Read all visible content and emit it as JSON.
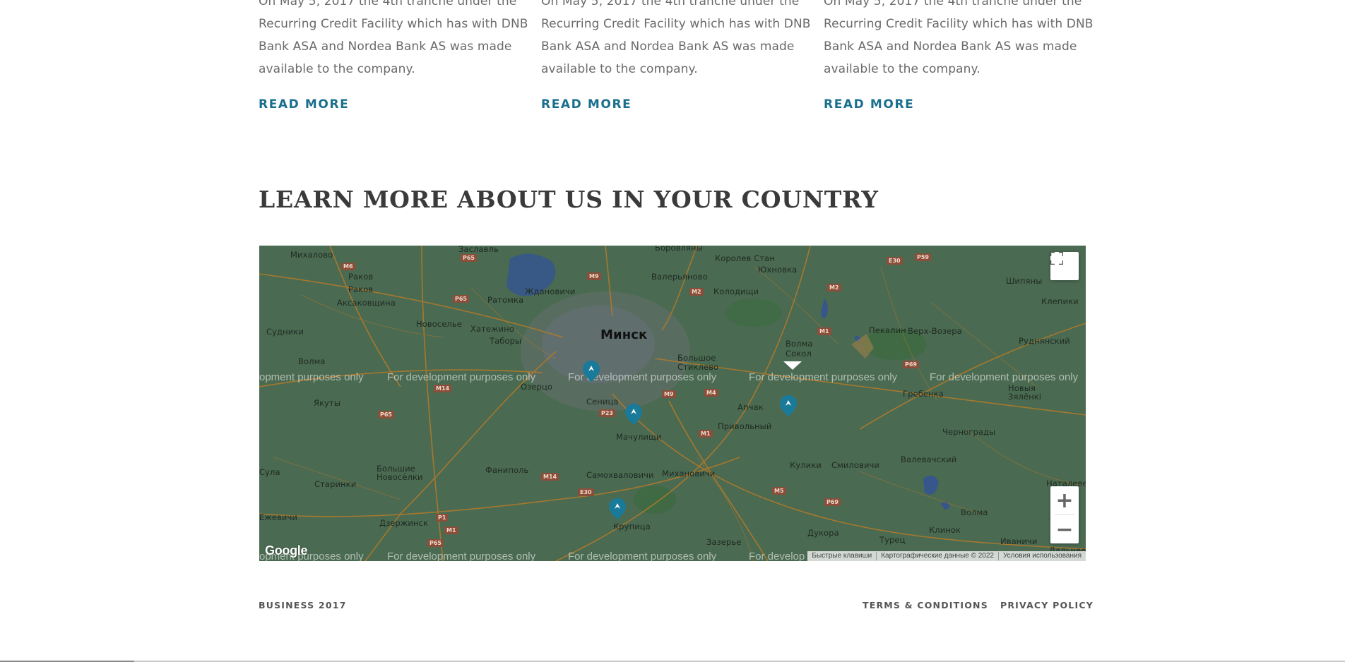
{
  "news": [
    {
      "lines": [
        "On May 5, 2017 the 4th tranche under the",
        "Recurring Credit Facility which has with DNB",
        "Bank ASA and Nordea Bank AS was made",
        "available to the company."
      ],
      "read_more": "READ MORE"
    },
    {
      "lines": [
        "On May 5, 2017 the 4th tranche under the",
        "Recurring Credit Facility which has with DNB",
        "Bank ASA and Nordea Bank AS was made",
        "available to the company."
      ],
      "read_more": "READ MORE"
    },
    {
      "lines": [
        "On May 5, 2017 the 4th tranche under the",
        "Recurring Credit Facility which has with DNB",
        "Bank ASA and Nordea Bank AS was made",
        "available to the company."
      ],
      "read_more": "READ MORE"
    }
  ],
  "section": {
    "heading": "LEARN MORE ABOUT US IN YOUR COUNTRY"
  },
  "map": {
    "city": "Минск",
    "places": [
      "Михалово",
      "Раков",
      "Раков",
      "Аксаковщина",
      "Судники",
      "Волма",
      "Якуты",
      "Сула",
      "Старинки",
      "Ежевичи",
      "Дзержинск",
      "Заславль",
      "Ратомка",
      "Ждановичи",
      "Новоселье",
      "Хатежино",
      "Таборы",
      "Озерцо",
      "Сеница",
      "Мачулищи",
      "Фаниполь",
      "Большие Новосёлки",
      "Самохваловичи",
      "Михановичи",
      "Крупица",
      "Боровляны",
      "Валерьяново",
      "Королев Стан",
      "Юхновка",
      "Колодищи",
      "Большое Стиклево",
      "Волма Сокол",
      "Апчак",
      "Привольный",
      "Кулики",
      "Смиловичи",
      "Пекалин",
      "Верх-Возера",
      "Шипяны",
      "Клепики",
      "Руднянский",
      "Гребенка",
      "Новыя Зялёнкі",
      "Чернограды",
      "Валевачский",
      "Волма",
      "Клинок",
      "Иваничи",
      "Турец",
      "Дукора",
      "Зазерье",
      "Наталеве",
      "Дальнее"
    ],
    "watermark": "For development purposes only",
    "watermark_left": "opment purposes only",
    "watermark_right": "For develop",
    "road_labels": [
      "М6",
      "Р65",
      "Р65",
      "М9",
      "М2",
      "Р59",
      "Е30",
      "М2",
      "М1",
      "М14",
      "Р65",
      "Р23",
      "М9",
      "М4",
      "М1",
      "Р69",
      "Р69",
      "М5",
      "М14",
      "Е30",
      "Р1",
      "М1",
      "Р65"
    ],
    "logo": "Google",
    "attribution": [
      "Быстрые клавиши",
      "Картографические данные © 2022",
      "Условия использования"
    ],
    "zoom_in": "+",
    "zoom_out": "−",
    "fullscreen_icon": "fullscreen-icon",
    "marker_color": "#1a7a9a",
    "map_bg": "#4b6a52"
  },
  "footer": {
    "brand": "BUSINESS 2017",
    "links": [
      "TERMS & CONDITIONS",
      "PRIVACY POLICY"
    ]
  }
}
